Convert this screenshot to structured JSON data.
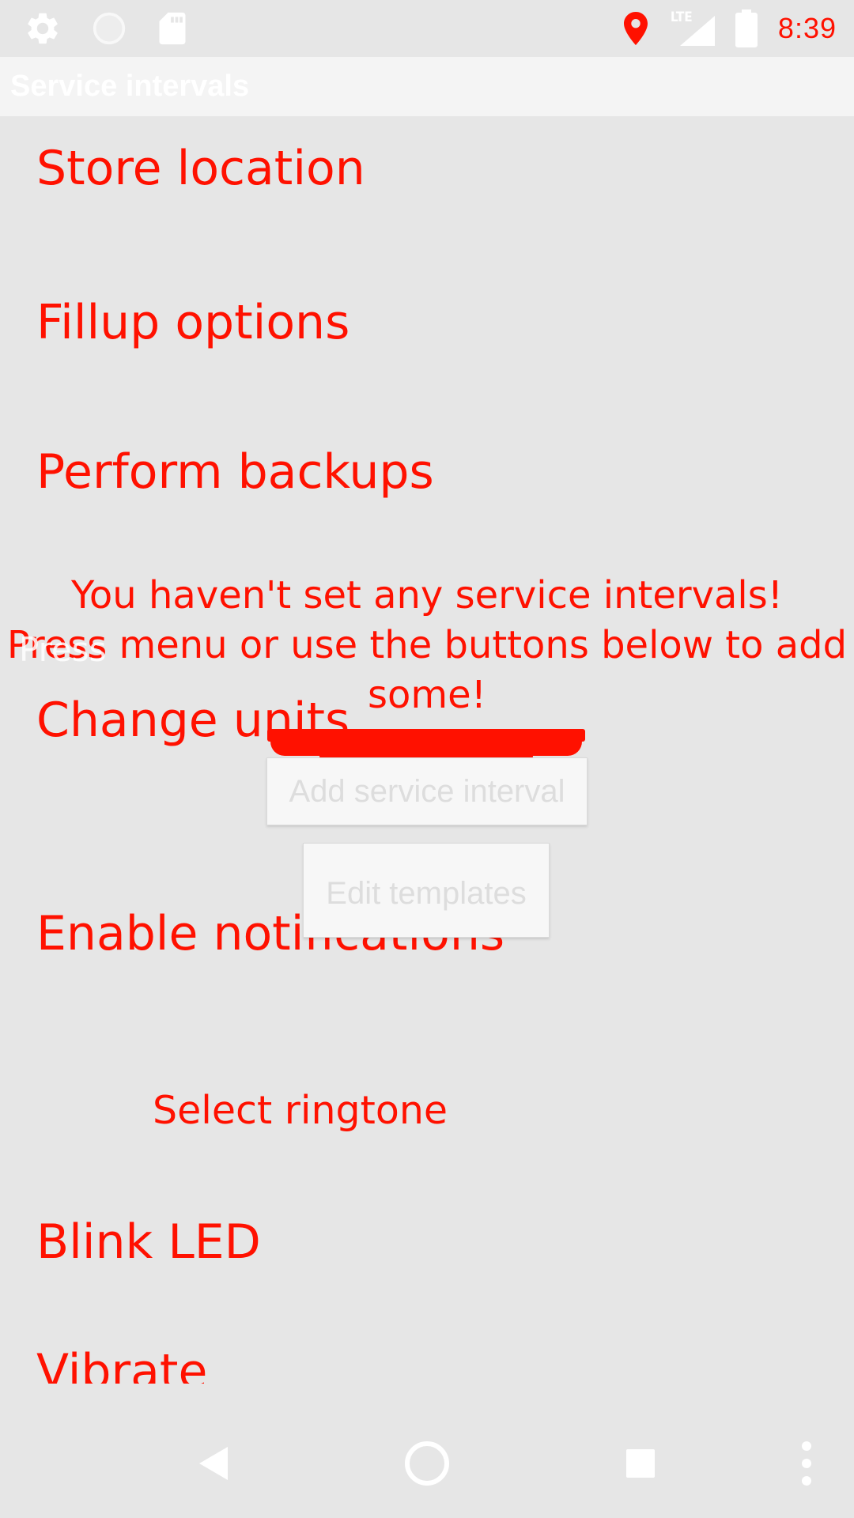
{
  "status_bar": {
    "network_type": "LTE",
    "time": "8:39",
    "left_icons": [
      "gear-icon",
      "circle-icon",
      "sd-card-icon"
    ],
    "right_icons": [
      "location-pin-icon",
      "signal-icon",
      "battery-icon"
    ],
    "accent_color": "#ff1100"
  },
  "title_bar": {
    "title": "Service intervals"
  },
  "preferences": {
    "store_location": "Store location",
    "fillup_options": "Fillup options",
    "perform_backups": "Perform backups",
    "change_units": "Change units",
    "enable_notifications": "Enable notifications",
    "select_ringtone": "Select ringtone",
    "blink_led": "Blink LED",
    "vibrate": "Vibrate"
  },
  "empty_state": {
    "line1": "You haven't set any service intervals!",
    "line2": "Press menu or use the buttons below to add",
    "line3": "some!",
    "ghost_text": "Press"
  },
  "buttons": {
    "add_service_interval": "Add service interval",
    "edit_templates": "Edit templates"
  },
  "nav_bar": {
    "icons": [
      "back-icon",
      "home-icon",
      "recents-icon",
      "more-options-icon"
    ]
  }
}
